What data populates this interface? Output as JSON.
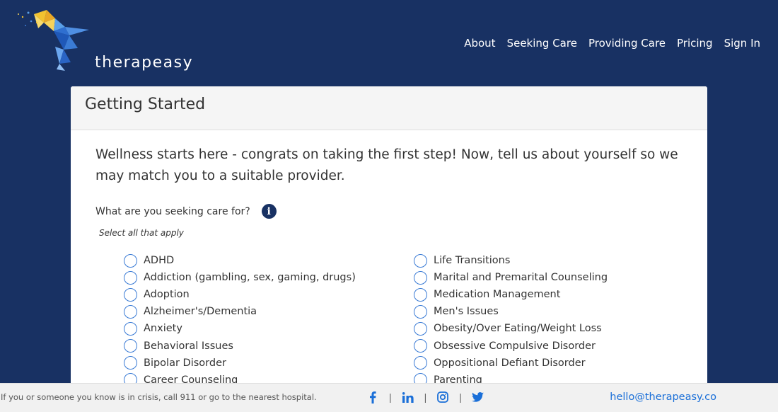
{
  "brand": {
    "name": "therapeasy"
  },
  "nav": {
    "items": [
      {
        "label": "About"
      },
      {
        "label": "Seeking Care"
      },
      {
        "label": "Providing Care"
      },
      {
        "label": "Pricing"
      },
      {
        "label": "Sign In"
      }
    ]
  },
  "card": {
    "title": "Getting Started",
    "intro": "Wellness starts here - congrats on taking the first step! Now, tell us about yourself so we may match you to a suitable provider.",
    "question": "What are you seeking care for?",
    "hint": "Select all that apply",
    "options": [
      {
        "label": "ADHD"
      },
      {
        "label": "Addiction (gambling, sex, gaming, drugs)"
      },
      {
        "label": "Adoption"
      },
      {
        "label": "Alzheimer's/Dementia"
      },
      {
        "label": "Anxiety"
      },
      {
        "label": "Behavioral Issues"
      },
      {
        "label": "Bipolar Disorder"
      },
      {
        "label": "Career Counseling"
      },
      {
        "label": "Life Transitions"
      },
      {
        "label": "Marital and Premarital Counseling"
      },
      {
        "label": "Medication Management"
      },
      {
        "label": "Men's Issues"
      },
      {
        "label": "Obesity/Over Eating/Weight Loss"
      },
      {
        "label": "Obsessive Compulsive Disorder"
      },
      {
        "label": "Oppositional Defiant Disorder"
      },
      {
        "label": "Parenting"
      }
    ]
  },
  "footer": {
    "crisis": "If you or someone you know is in crisis, call 911 or go to the nearest hospital.",
    "social_icons": [
      "facebook-icon",
      "linkedin-icon",
      "instagram-icon",
      "twitter-icon"
    ],
    "separator": "|",
    "email": "hello@therapeasy.co"
  },
  "colors": {
    "header_bg": "#183163",
    "accent": "#3a7bd5",
    "link": "#1a6fd8",
    "footer_bg": "#f1f1f1"
  }
}
